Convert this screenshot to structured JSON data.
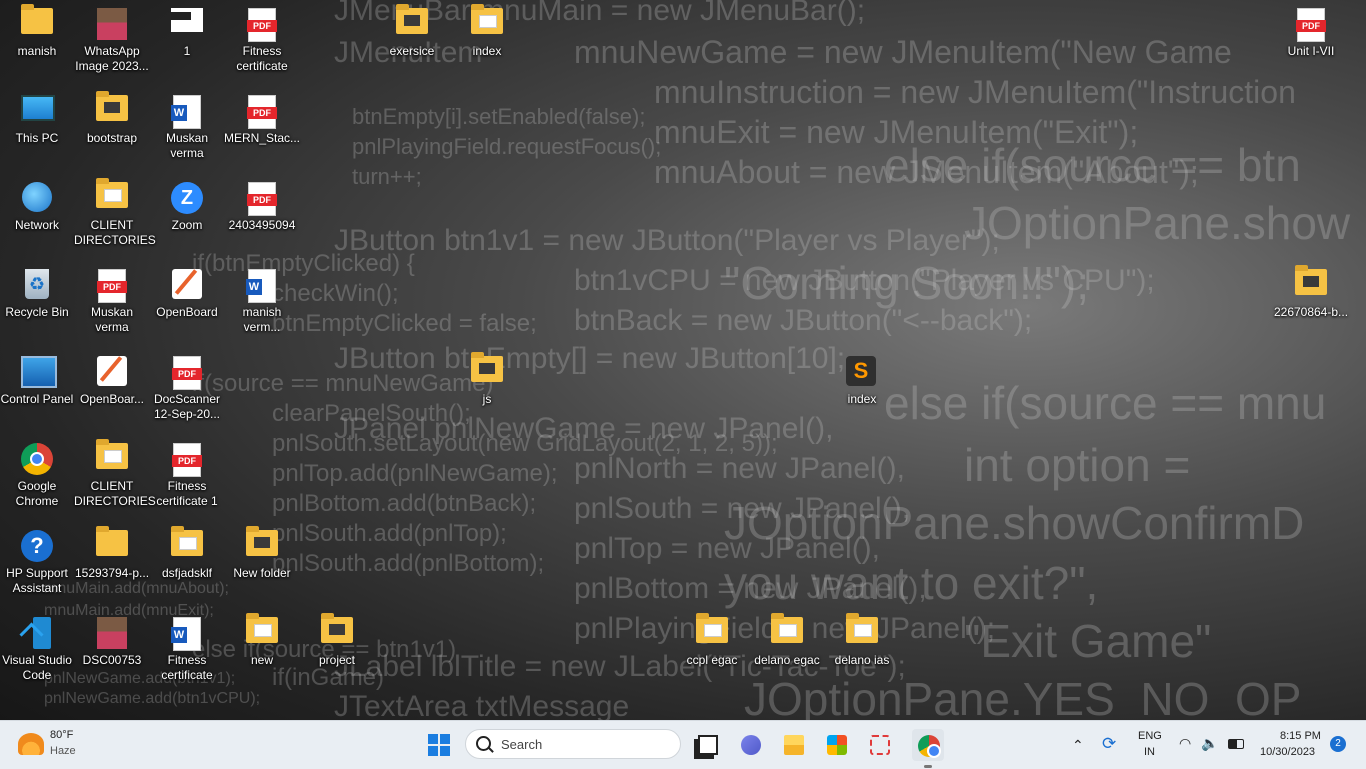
{
  "wallpaper": {
    "lines": [
      "JMenuBar mnuMain = new JMenuBar();",
      "JMenuItem",
      "mnuNewGame = new JMenuItem(\"New Game",
      "mnuInstruction = new JMenuItem(\"Instruction",
      "mnuExit = new JMenuItem(\"Exit\");",
      "mnuAbout = new JMenuItem(\"About\");",
      "btnEmpty[i].setEnabled(false);",
      "pnlPlayingField.requestFocus();",
      "turn++;",
      "else if(source == btn",
      "JOptionPane.show",
      "JButton    btn1v1 = new JButton(\"Player vs Player\");",
      "btn1vCPU = new JButton(\"Player vs CPU\");",
      "\"Coming Soon!!\");",
      "if(btnEmptyClicked) {",
      "checkWin();",
      "btnEmptyClicked = false;",
      "btnBack = new JButton(\"<--back\");",
      "JButton btnEmpty[] = new JButton[10];",
      "if(source == mnuNewGame)",
      "else if(source == mnu",
      "clearPanelSouth();",
      "JPanel    pnlNewGame = new JPanel(),",
      "pnlSouth.setLayout(new GridLayout(2, 1, 2, 5));",
      "pnlNorth = new JPanel(),",
      "int option =",
      "pnlTop.add(pnlNewGame);",
      "pnlBottom.add(btnBack);",
      "pnlSouth = new JPanel(),",
      "JOptionPane.showConfirmD",
      "pnlSouth.add(pnlTop);",
      "pnlTop = new JPanel(),",
      "pnlSouth.add(pnlBottom);",
      "you want to exit?\",",
      "pnlBottom = new JPanel(),",
      "pnlPlayingField = new JPanel();",
      "\"Exit Game\"",
      "else if(source == btn1v1)",
      "if(inGame)",
      "JLabel lblTitle = new JLabel(\"Tic-Tac-Toe\");",
      "JTextArea txtMessage",
      "JOptionPane.YES_NO_OP",
      "mnuMain.add(mnuAbout);",
      "mnuMain.add(mnuExit);",
      "pnlNewGame.add(btn1v1);",
      "pnlNewGame.add(btn1vCPU);"
    ]
  },
  "desktop_icons": [
    {
      "label": "manish",
      "icon": "folder-icon"
    },
    {
      "label": "WhatsApp Image 2023...",
      "icon": "image-icon"
    },
    {
      "label": "1",
      "icon": "file-icon"
    },
    {
      "label": "Fitness certificate",
      "icon": "pdf-icon"
    },
    {
      "label": "exersice",
      "icon": "folder-icon"
    },
    {
      "label": "index",
      "icon": "folder-icon"
    },
    {
      "label": "Unit I-VII",
      "icon": "pdf-icon"
    },
    {
      "label": "This PC",
      "icon": "computer-icon"
    },
    {
      "label": "bootstrap",
      "icon": "folder-icon"
    },
    {
      "label": "Muskan verma",
      "icon": "word-icon"
    },
    {
      "label": "MERN_Stac...",
      "icon": "pdf-icon"
    },
    {
      "label": "Network",
      "icon": "network-icon"
    },
    {
      "label": "CLIENT DIRECTORIES",
      "icon": "folder-icon"
    },
    {
      "label": "Zoom",
      "icon": "zoom-icon"
    },
    {
      "label": "2403495094",
      "icon": "pdf-icon"
    },
    {
      "label": "Recycle Bin",
      "icon": "recycle-bin-icon"
    },
    {
      "label": "Muskan verma",
      "icon": "pdf-icon"
    },
    {
      "label": "OpenBoard",
      "icon": "openboard-icon"
    },
    {
      "label": "manish verm...",
      "icon": "word-icon"
    },
    {
      "label": "22670864-b...",
      "icon": "folder-icon"
    },
    {
      "label": "js",
      "icon": "folder-icon"
    },
    {
      "label": "index",
      "icon": "sublime-icon"
    },
    {
      "label": "Control Panel",
      "icon": "control-panel-icon"
    },
    {
      "label": "OpenBoar...",
      "icon": "openboard-icon"
    },
    {
      "label": "DocScanner 12-Sep-20...",
      "icon": "pdf-icon"
    },
    {
      "label": "Google Chrome",
      "icon": "chrome-icon"
    },
    {
      "label": "CLIENT DIRECTORIES",
      "icon": "folder-icon"
    },
    {
      "label": "Fitness certificate 1",
      "icon": "pdf-icon"
    },
    {
      "label": "HP Support Assistant",
      "icon": "help-icon"
    },
    {
      "label": "15293794-p...",
      "icon": "folder-icon"
    },
    {
      "label": "dsfjadsklf",
      "icon": "folder-icon"
    },
    {
      "label": "New folder",
      "icon": "folder-icon"
    },
    {
      "label": "Visual Studio Code",
      "icon": "vscode-icon"
    },
    {
      "label": "DSC00753",
      "icon": "image-icon"
    },
    {
      "label": "Fitness certificate",
      "icon": "word-icon"
    },
    {
      "label": "new",
      "icon": "folder-icon"
    },
    {
      "label": "project",
      "icon": "folder-icon"
    },
    {
      "label": "ccpl egac",
      "icon": "folder-icon"
    },
    {
      "label": "delano egac",
      "icon": "folder-icon"
    },
    {
      "label": "delano ias",
      "icon": "folder-icon"
    }
  ],
  "taskbar": {
    "weather_temp": "80°F",
    "weather_condition": "Haze",
    "search_placeholder": "Search",
    "pinned_apps": [
      "task-view-icon",
      "teams-chat-icon",
      "file-explorer-icon",
      "microsoft-store-icon",
      "snipping-tool-icon",
      "chrome-icon"
    ],
    "language_top": "ENG",
    "language_bottom": "IN",
    "time": "8:15 PM",
    "date": "10/30/2023",
    "notification_count": "2"
  },
  "colors": {
    "folder": "#f6c244",
    "pdf_red": "#e4262c",
    "word_blue": "#185abd",
    "accent": "#1a7de0"
  }
}
